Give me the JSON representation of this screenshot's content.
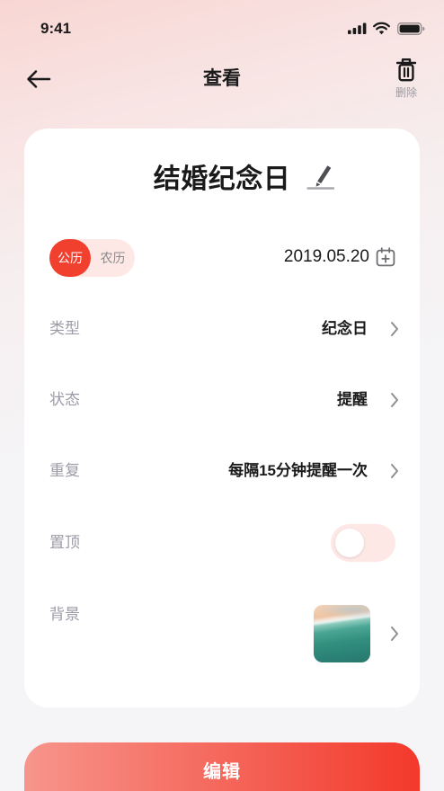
{
  "status_bar": {
    "time": "9:41",
    "icons": [
      "cellular-signal-icon",
      "wifi-icon",
      "battery-icon"
    ]
  },
  "header": {
    "title": "查看",
    "delete_label": "删除",
    "icons": {
      "back": "arrow-left-icon",
      "delete": "trash-icon"
    }
  },
  "event": {
    "title": "结婚纪念日",
    "title_icon": "pencil-icon",
    "calendar_modes": [
      {
        "label": "公历",
        "active": true
      },
      {
        "label": "农历",
        "active": false
      }
    ],
    "date": "2019.05.20",
    "date_icon": "calendar-plus-icon"
  },
  "rows": {
    "type": {
      "label": "类型",
      "value": "纪念日"
    },
    "status": {
      "label": "状态",
      "value": "提醒"
    },
    "repeat": {
      "label": "重复",
      "value": "每隔15分钟提醒一次"
    },
    "pin": {
      "label": "置顶",
      "enabled": false
    },
    "background": {
      "label": "背景"
    },
    "disclosure_icon": "chevron-right-icon"
  },
  "actions": {
    "edit_label": "编辑"
  },
  "colors": {
    "accent": "#f2402f",
    "accent_light": "#fde8e6",
    "label": "#9c9ca8",
    "text": "#1a1a1a",
    "chevron": "#8e8e93",
    "button_gradient_start": "#f7958c",
    "button_gradient_end": "#f3392b"
  }
}
